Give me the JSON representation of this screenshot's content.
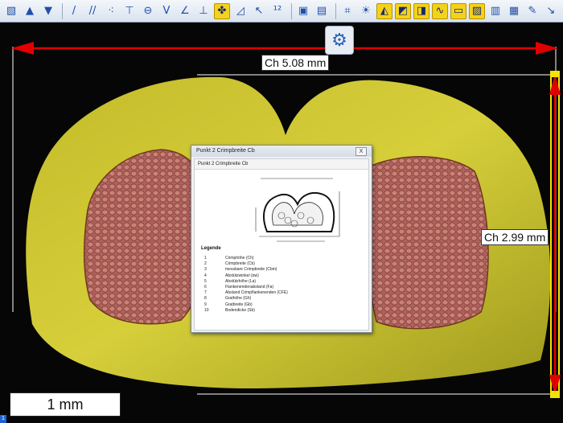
{
  "toolbar": {
    "icons": [
      "image-icon",
      "arrow-up-icon",
      "arrow-down-icon",
      "line-icon",
      "parallel-lines-icon",
      "points-icon",
      "perpendicular-icon",
      "circle-icon",
      "angle-icon",
      "angle-arc-icon",
      "baseline-icon",
      "height-icon",
      "fan-icon",
      "cross-section-icon",
      "cursor-points-icon",
      "numbering-icon",
      "measure-image-icon",
      "save-image-icon",
      "crop-icon",
      "brightness-icon",
      "contrast-icon",
      "gradient-icon",
      "fill-icon",
      "wave-icon",
      "overlay-icon",
      "hatch-icon",
      "color-layer-icon",
      "web-icon",
      "pencil-icon",
      "arrow-diagonal-icon"
    ]
  },
  "measurements": {
    "width_label": "Ch 5.08 mm",
    "height_label": "Ch 2.99 mm"
  },
  "scale_bar": {
    "label": "1 mm"
  },
  "dialog": {
    "title": "Punkt 2 Crimpbreite Cb",
    "close": "X",
    "header": "Punkt 2 Crimpbreite Cb",
    "legend_title": "Legende",
    "legend": [
      {
        "n": "1",
        "t": "Crimphöhe (Ch)"
      },
      {
        "n": "2",
        "t": "Crimpbreite (Cb)"
      },
      {
        "n": "3",
        "t": "messbare Crimpbreite (Cbm)"
      },
      {
        "n": "4",
        "t": "Abstützwinkel (αw)"
      },
      {
        "n": "5",
        "t": "Abstützhöhe (La)"
      },
      {
        "n": "6",
        "t": "Flankenendenabstand (Fa)"
      },
      {
        "n": "7",
        "t": "Abstand Crimpflankenenden (CFE)"
      },
      {
        "n": "8",
        "t": "Grathöhe (Gh)"
      },
      {
        "n": "9",
        "t": "Gratbreite (Gb)"
      },
      {
        "n": "10",
        "t": "Bodendicke (Sb)"
      }
    ]
  },
  "colors": {
    "accent": "#1f4fa8",
    "measure": "#e00000",
    "highlight": "#f5e400"
  }
}
